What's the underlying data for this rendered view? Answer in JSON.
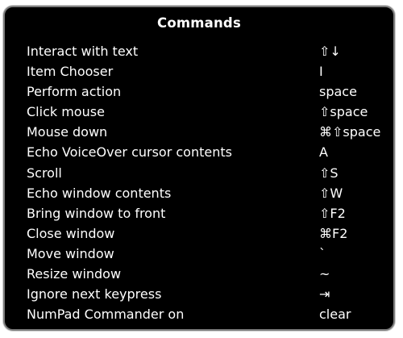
{
  "panel": {
    "title": "Commands"
  },
  "commands": [
    {
      "label": "Interact with text",
      "key": "⇧↓"
    },
    {
      "label": "Item Chooser",
      "key": "I"
    },
    {
      "label": "Perform action",
      "key": "space"
    },
    {
      "label": "Click mouse",
      "key": "⇧space"
    },
    {
      "label": "Mouse down",
      "key": "⌘⇧space"
    },
    {
      "label": "Echo VoiceOver cursor contents",
      "key": "A"
    },
    {
      "label": "Scroll",
      "key": "⇧S"
    },
    {
      "label": "Echo window contents",
      "key": "⇧W"
    },
    {
      "label": "Bring window to front",
      "key": "⇧F2"
    },
    {
      "label": "Close window",
      "key": "⌘F2"
    },
    {
      "label": "Move window",
      "key": "`"
    },
    {
      "label": "Resize window",
      "key": "~"
    },
    {
      "label": "Ignore next keypress",
      "key": "⇥"
    },
    {
      "label": "NumPad Commander on",
      "key": "clear"
    }
  ],
  "colors": {
    "panel_background": "#000000",
    "panel_border": "#7d7d7d",
    "text": "#ffffff"
  }
}
